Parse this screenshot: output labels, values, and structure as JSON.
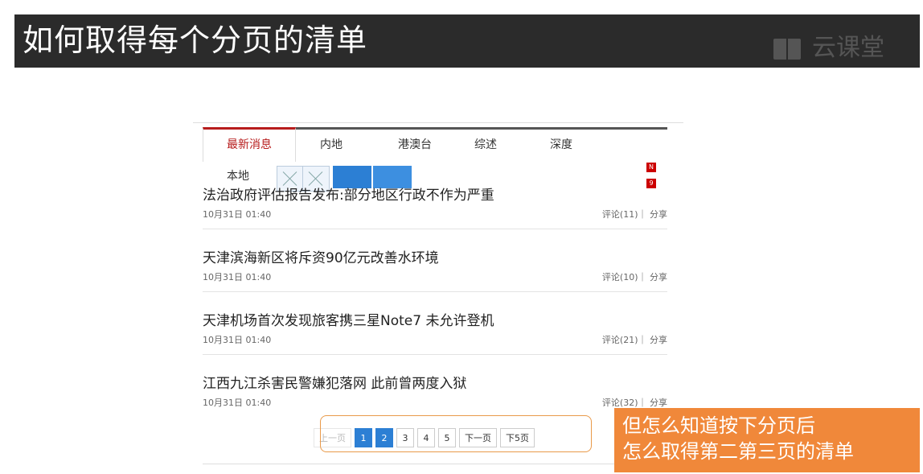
{
  "header": {
    "title": "如何取得每个分页的清单",
    "logo_text": "云课堂"
  },
  "tabs": [
    {
      "label": "最新消息"
    },
    {
      "label": "内地"
    },
    {
      "label": "港澳台"
    },
    {
      "label": "综述"
    },
    {
      "label": "深度"
    }
  ],
  "subtab": {
    "label": "本地"
  },
  "badges": [
    "N",
    "9"
  ],
  "news": [
    {
      "title": "法治政府评估报告发布:部分地区行政不作为严重",
      "time": "10月31日 01:40",
      "meta": "评论(11)｜ 分享"
    },
    {
      "title": "天津滨海新区将斥资90亿元改善水环境",
      "time": "10月31日 01:40",
      "meta": "评论(10)｜ 分享"
    },
    {
      "title": "天津机场首次发现旅客携三星Note7 未允许登机",
      "time": "10月31日 01:40",
      "meta": "评论(21)｜ 分享"
    },
    {
      "title": "江西九江杀害民警嫌犯落网 此前曾两度入狱",
      "time": "10月31日 01:40",
      "meta": "评论(32)｜ 分享"
    }
  ],
  "pager": {
    "prev": "上一页",
    "pages": [
      "1",
      "2",
      "3",
      "4",
      "5"
    ],
    "current": "2",
    "next": "下一页",
    "next5": "下5页"
  },
  "callout": {
    "line1": "但怎么知道按下分页后",
    "line2": "怎么取得第二第三页的清单"
  },
  "colors": {
    "accent": "#f0883a",
    "active_tab": "#b71c1c",
    "pager_blue": "#2c7fd4",
    "title_bg": "#2b2b2b"
  }
}
